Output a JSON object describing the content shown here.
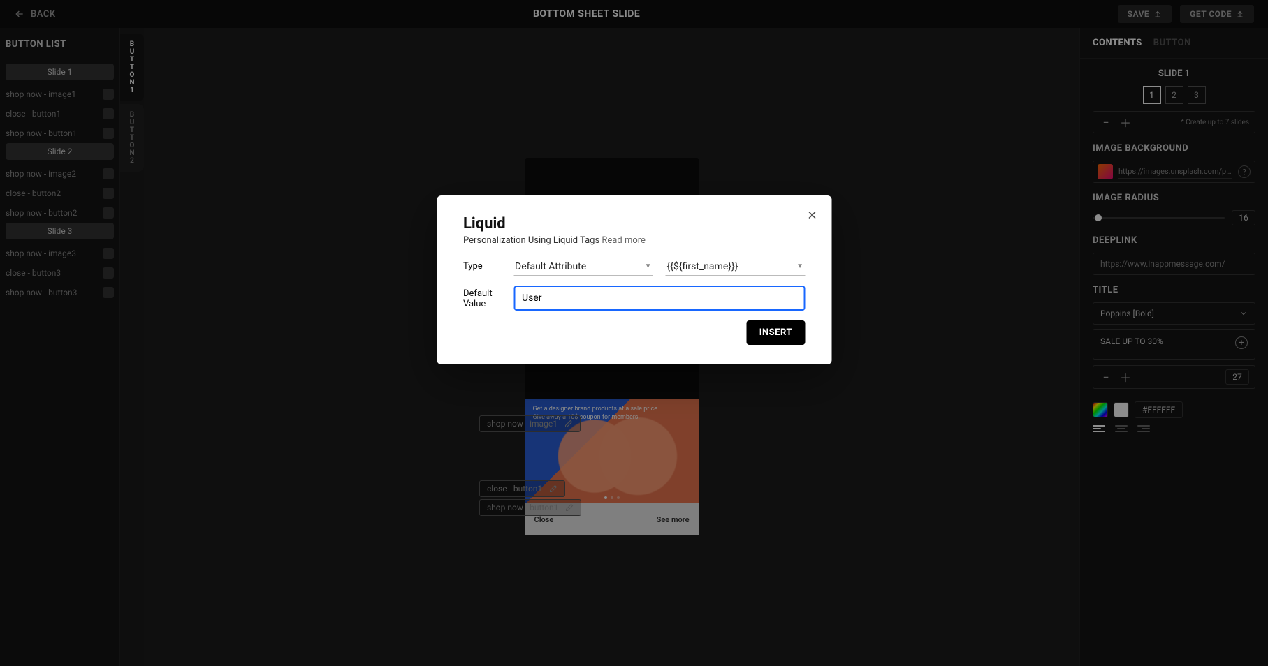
{
  "header": {
    "back_label": "BACK",
    "title": "BOTTOM SHEET SLIDE",
    "save_label": "SAVE",
    "get_code_label": "GET CODE"
  },
  "left_sidebar": {
    "title": "BUTTON LIST",
    "slides": [
      {
        "label": "Slide 1",
        "buttons": [
          "shop now - image1",
          "close - button1",
          "shop now - button1"
        ]
      },
      {
        "label": "Slide 2",
        "buttons": [
          "shop now - image2",
          "close - button2",
          "shop now - button2"
        ]
      },
      {
        "label": "Slide 3",
        "buttons": [
          "shop now - image3",
          "close - button3",
          "shop now - button3"
        ]
      }
    ]
  },
  "vertical_tabs": [
    {
      "label": "BUTTON1",
      "active": true
    },
    {
      "label": "BUTTON2",
      "active": false
    }
  ],
  "canvas": {
    "labels": [
      "shop now - image1",
      "close - button1",
      "shop now - button1"
    ],
    "sheet": {
      "line1": "Get a designer brand products at a sale price.",
      "line2": "Give away a 10$ coupon for members.",
      "close": "Close",
      "see_more": "See more"
    }
  },
  "right_panel": {
    "tabs": {
      "contents": "CONTENTS",
      "button": "BUTTON"
    },
    "slide_heading": "SLIDE 1",
    "slide_numbers": [
      "1",
      "2",
      "3"
    ],
    "slides_note": "* Create up to 7 slides",
    "image_bg_title": "IMAGE BACKGROUND",
    "image_url": "https://images.unsplash.com/photo-...",
    "image_radius_title": "IMAGE RADIUS",
    "image_radius_value": "16",
    "deeplink_title": "DEEPLINK",
    "deeplink_value": "https://www.inappmessage.com/",
    "title_title": "TITLE",
    "font_value": "Poppins [Bold]",
    "title_value": "SALE UP TO 30%",
    "font_size_value": "27",
    "color_code": "#FFFFFF"
  },
  "modal": {
    "title": "Liquid",
    "subtitle": "Personalization Using Liquid Tags",
    "read_more": "Read more",
    "type_label": "Type",
    "type_value": "Default Attribute",
    "attribute_value": "{{${first_name}}}",
    "default_label": "Default Value",
    "default_value": "User",
    "insert_label": "INSERT"
  }
}
